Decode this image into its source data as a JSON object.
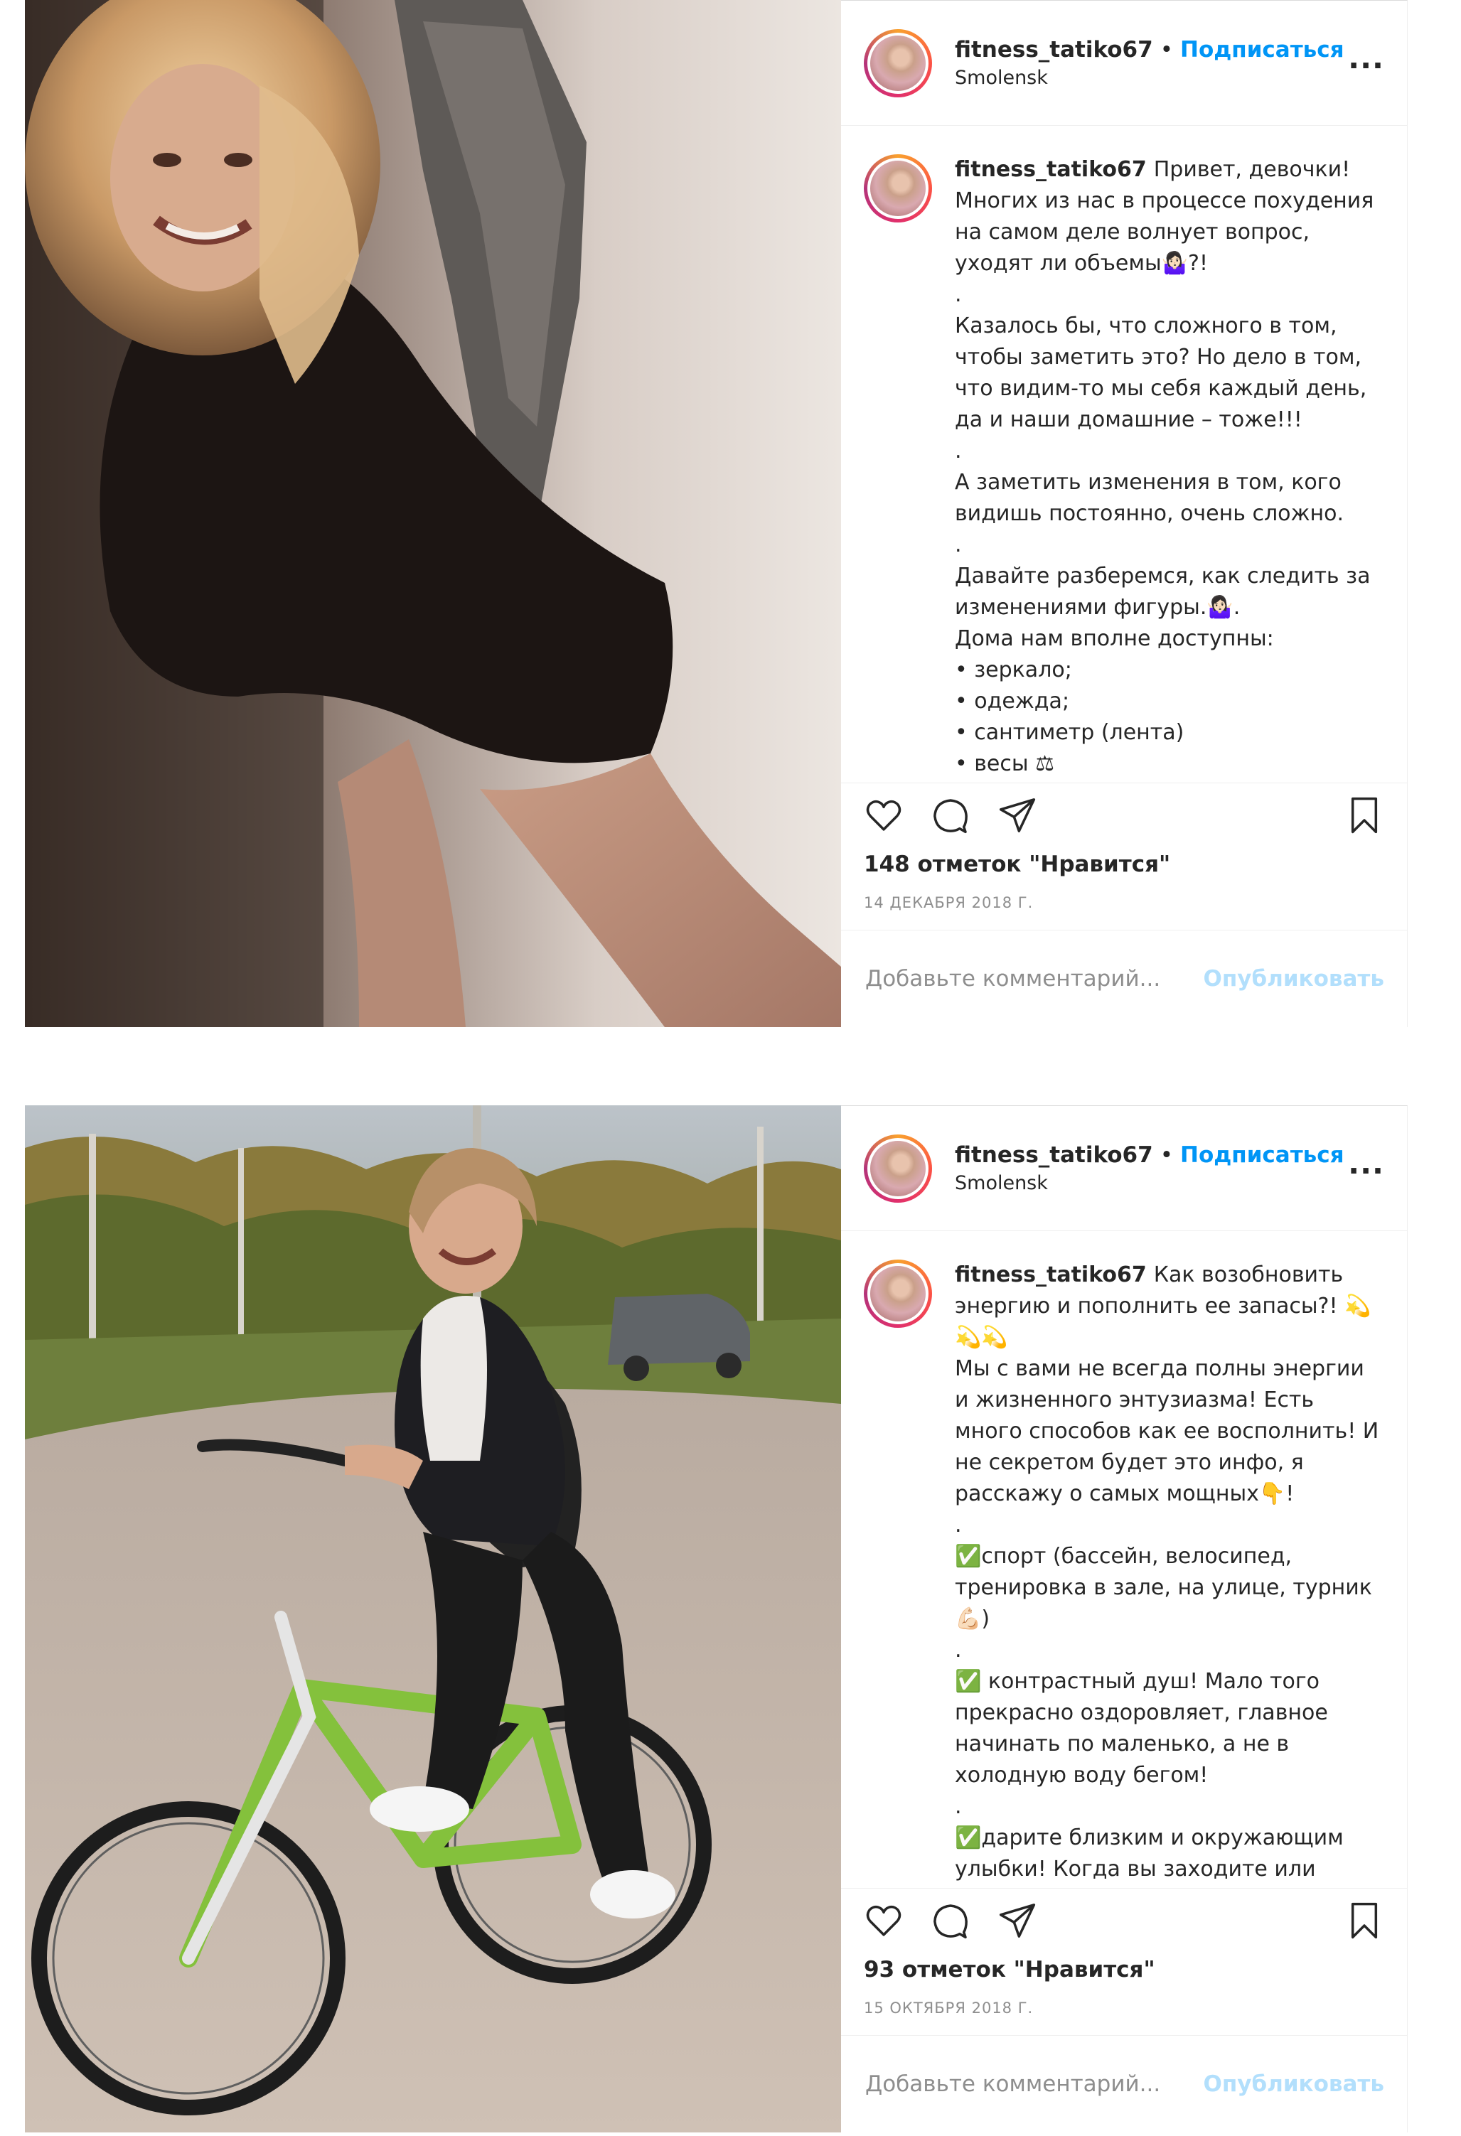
{
  "posts": [
    {
      "username": "fitness_tatiko67",
      "separator": "•",
      "follow_label": "Подписаться",
      "location": "Smolensk",
      "more_label": "...",
      "caption": "Привет, девочки!\nМногих из нас в процессе похудения на самом деле волнует вопрос, уходят ли объемы🤷🏻‍♀️?!\n.\nКазалось бы, что сложного в том, чтобы заметить это? Но дело в том, что видим-то мы себя каждый день, да и наши домашние – тоже!!!\n.\nА заметить изменения в том, кого видишь постоянно, очень сложно.\n.\nДавайте разберемся, как следить за изменениями фигуры.🤷🏻‍♀️.\nДома нам вполне доступны:\n• зеркало;\n• одежда;\n• сантиметр (лента)\n• весы ⚖",
      "likes": "148 отметок \"Нравится\"",
      "date": "14 ДЕКАБРЯ 2018 Г.",
      "comment_placeholder": "Добавьте комментарий...",
      "publish_label": "Опубликовать"
    },
    {
      "username": "fitness_tatiko67",
      "separator": "•",
      "follow_label": "Подписаться",
      "location": "Smolensk",
      "more_label": "...",
      "caption": "Как возобновить энергию и пополнить ее запасы?! 💫💫💫\nМы с вами не всегда полны энергии и жизненного энтузиазма! Есть много способов как ее восполнить! И не секретом будет это инфо, я расскажу о самых мощных👇!\n.\n✅спорт (бассейн, велосипед, тренировка в зале, на улице, турник 💪🏻)\n.\n✅ контрастный душ! Мало того прекрасно оздоровляет, главное начинать по маленько, а не в холодную воду бегом!\n.\n✅дарите близким и окружающим улыбки! Когда вы заходите или",
      "likes": "93 отметок \"Нравится\"",
      "date": "15 ОКТЯБРЯ 2018 Г.",
      "comment_placeholder": "Добавьте комментарий...",
      "publish_label": "Опубликовать"
    }
  ],
  "icons": {
    "like": "heart-icon",
    "comment": "comment-icon",
    "share": "share-icon",
    "save": "bookmark-icon"
  },
  "colors": {
    "link_blue": "#0095f6",
    "publish_disabled": "#b2dffc",
    "muted_text": "#8e8e8e",
    "border": "#efefef"
  }
}
